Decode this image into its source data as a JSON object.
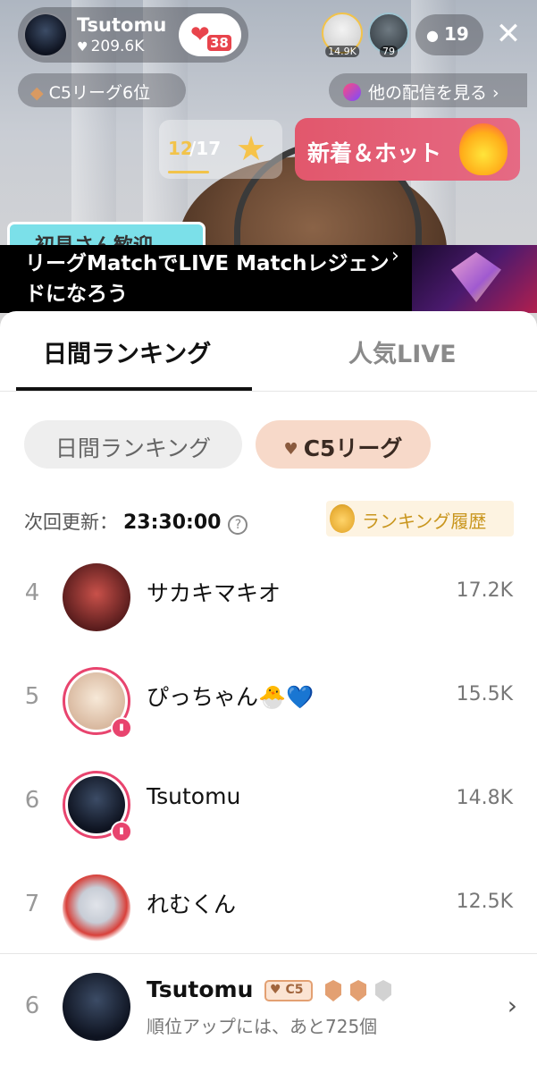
{
  "stream": {
    "host_name": "Tsutomu",
    "host_likes": "209.6K",
    "host_badge_num": "38",
    "viewer1_count": "14.9K",
    "viewer2_count": "79",
    "viewer_total": "19",
    "league_label": "C5リーグ6位",
    "other_streams_label": "他の配信を見る",
    "counter_current": "12",
    "counter_total": "/17",
    "hot_label": "新着＆ホット",
    "sticker_text": "初見さん歓迎",
    "banner_text": "リーグMatchでLIVE Matchレジェンドになろう"
  },
  "sheet": {
    "tabs": [
      {
        "label": "日間ランキング"
      },
      {
        "label": "人気LIVE"
      }
    ],
    "chips": [
      {
        "label": "日間ランキング"
      },
      {
        "label": "C5リーグ"
      }
    ],
    "update_label": "次回更新：",
    "update_time": "23:30:00",
    "history_label": "ランキング履歴",
    "rows": [
      {
        "rank": "4",
        "name": "サカキマキオ",
        "score": "17.2K"
      },
      {
        "rank": "5",
        "name": "ぴっちゃん🐣💙",
        "score": "15.5K"
      },
      {
        "rank": "6",
        "name": "Tsutomu",
        "score": "14.8K"
      },
      {
        "rank": "7",
        "name": "れむくん",
        "score": "12.5K"
      }
    ],
    "self": {
      "rank": "6",
      "name": "Tsutomu",
      "tag": "C5",
      "subtitle": "順位アップには、あと725個"
    }
  },
  "colors": {
    "accent_pink": "#e8446e",
    "c5_chip_bg": "#f7d9c9",
    "gold": "#c9961e"
  },
  "icons": [
    "heart-icon",
    "close-icon",
    "person-icon",
    "diamond-icon",
    "star-icon",
    "flame-icon",
    "info-icon",
    "medal-icon",
    "chevron-right-icon",
    "shield-icon"
  ]
}
